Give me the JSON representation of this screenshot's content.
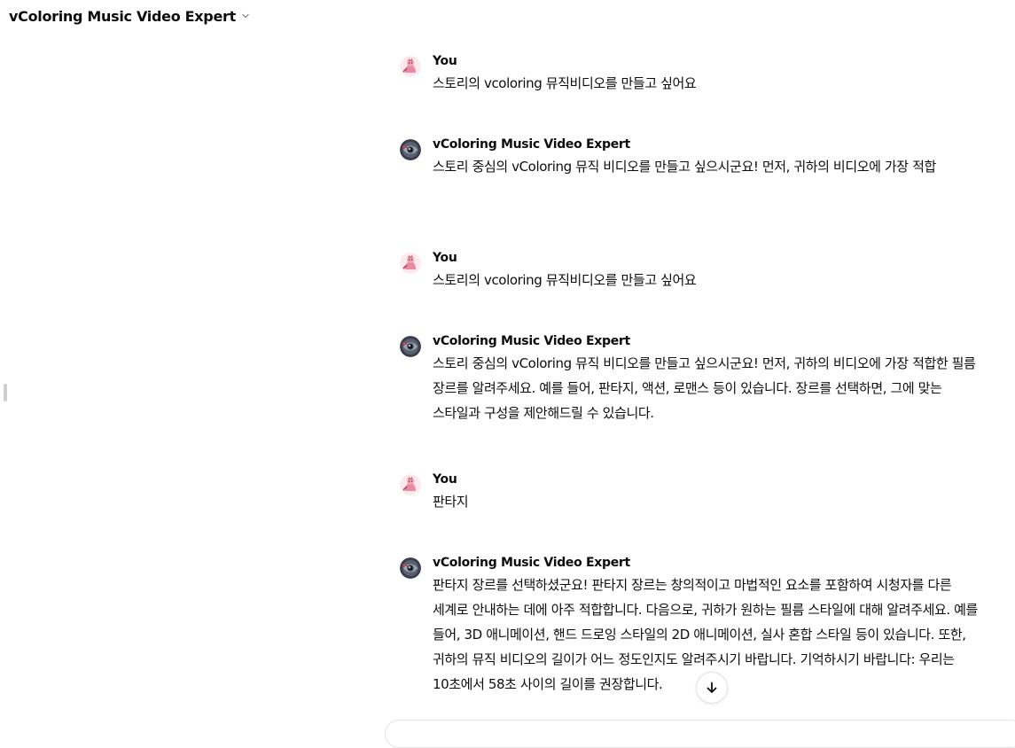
{
  "header": {
    "title": "vColoring Music Video Expert"
  },
  "messages": [
    {
      "role": "user",
      "author": "You",
      "text": "스토리의 vcoloring 뮤직비디오를 만들고 싶어요"
    },
    {
      "role": "assistant",
      "author": "vColoring Music Video Expert",
      "text": "스토리 중심의 vColoring 뮤직 비디오를 만들고 싶으시군요! 먼저, 귀하의 비디오에 가장 적합"
    },
    {
      "role": "user",
      "author": "You",
      "text": "스토리의 vcoloring 뮤직비디오를 만들고 싶어요"
    },
    {
      "role": "assistant",
      "author": "vColoring Music Video Expert",
      "text": "스토리 중심의 vColoring 뮤직 비디오를 만들고 싶으시군요! 먼저, 귀하의 비디오에 가장 적합한 필름 장르를 알려주세요. 예를 들어, 판타지, 액션, 로맨스 등이 있습니다. 장르를 선택하면, 그에 맞는 스타일과 구성을 제안해드릴 수 있습니다."
    },
    {
      "role": "user",
      "author": "You",
      "text": "판타지"
    },
    {
      "role": "assistant",
      "author": "vColoring Music Video Expert",
      "text": "판타지 장르를 선택하셨군요! 판타지 장르는 창의적이고 마법적인 요소를 포함하여 시청자를 다른 세계로 안내하는 데에 아주 적합합니다. 다음으로, 귀하가 원하는 필름 스타일에 대해 알려주세요. 예를 들어, 3D 애니메이션, 핸드 드로잉 스타일의 2D 애니메이션, 실사 혼합 스타일 등이 있습니다. 또한, 귀하의 뮤직 비디오의 길이가 어느 정도인지도 알려주시기 바랍니다. 기억하시기 바랍니다: 우리는 10초에서 58초 사이의 길이를 권장합니다."
    }
  ],
  "icons": {
    "header_chevron": "chevron-down-icon",
    "scroll": "arrow-down-icon",
    "user_avatar": "user-avatar-icon",
    "gpt_avatar": "gpt-avatar-icon"
  },
  "colors": {
    "text": "#0d0d0d",
    "user_avatar_bg": "#f4b6c2",
    "gpt_avatar_bg": "#3a3f4b"
  }
}
